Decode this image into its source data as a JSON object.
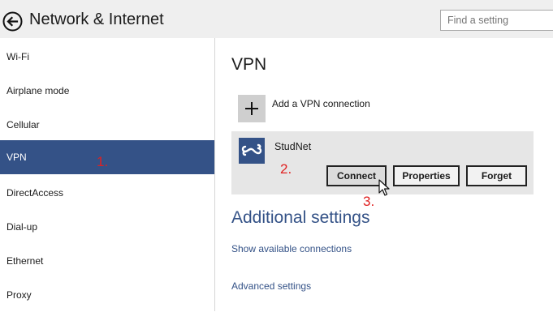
{
  "header": {
    "title": "Network & Internet",
    "search_placeholder": "Find a setting"
  },
  "sidebar": {
    "items": [
      {
        "label": "Wi-Fi"
      },
      {
        "label": "Airplane mode"
      },
      {
        "label": "Cellular"
      },
      {
        "label": "VPN",
        "selected": true
      },
      {
        "label": "DirectAccess"
      },
      {
        "label": "Dial-up"
      },
      {
        "label": "Ethernet"
      },
      {
        "label": "Proxy"
      }
    ]
  },
  "annotations": {
    "step1": "1.",
    "step2": "2.",
    "step3": "3."
  },
  "main": {
    "title": "VPN",
    "add_vpn_label": "Add a VPN connection",
    "vpn_connection": {
      "name": "StudNet",
      "connect_label": "Connect",
      "properties_label": "Properties",
      "forget_label": "Forget"
    },
    "additional": {
      "title": "Additional settings",
      "show_connections": "Show available connections",
      "advanced": "Advanced settings"
    }
  },
  "colors": {
    "accent": "#345287",
    "header_bg": "#efefef",
    "annotation": "#e02020",
    "card_bg": "#e6e6e6"
  },
  "icons": [
    "back-arrow-icon",
    "plus-icon",
    "vpn-chain-icon",
    "mouse-pointer-icon"
  ]
}
